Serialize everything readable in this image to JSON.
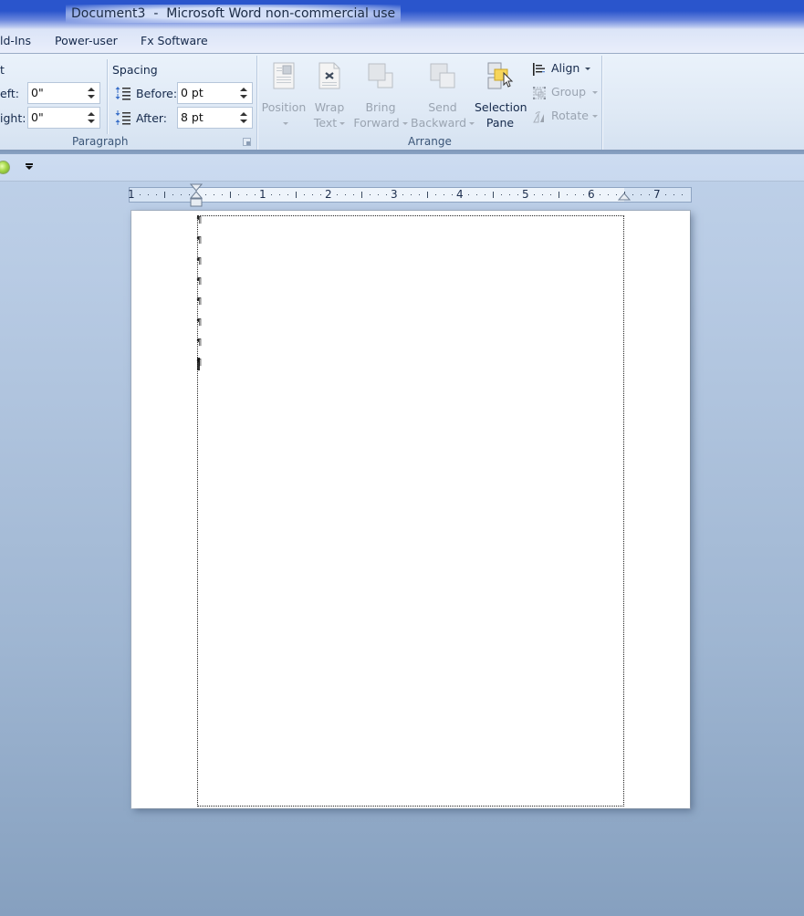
{
  "window": {
    "title": "Document3  -  Microsoft Word non-commercial use"
  },
  "tabs": [
    {
      "label": "ld-Ins"
    },
    {
      "label": "Power-user"
    },
    {
      "label": "Fx Software"
    }
  ],
  "ribbon": {
    "paragraph_group": {
      "label": "Paragraph",
      "indent": {
        "header_partial": "t",
        "left_label": "eft:",
        "left_value": "0\"",
        "right_label": "ight:",
        "right_value": "0\""
      },
      "spacing": {
        "header": "Spacing",
        "before_label": "Before:",
        "before_value": "0 pt",
        "after_label": "After:",
        "after_value": "8 pt"
      }
    },
    "arrange_group": {
      "label": "Arrange",
      "buttons": [
        {
          "line1": "Position",
          "line2": "",
          "enabled": false,
          "dropdown": true
        },
        {
          "line1": "Wrap",
          "line2": "Text",
          "enabled": false,
          "dropdown": true
        },
        {
          "line1": "Bring",
          "line2": "Forward",
          "enabled": false,
          "dropdown": true
        },
        {
          "line1": "Send",
          "line2": "Backward",
          "enabled": false,
          "dropdown": true
        },
        {
          "line1": "Selection",
          "line2": "Pane",
          "enabled": true,
          "dropdown": false
        }
      ],
      "small_buttons": [
        {
          "label": "Align",
          "enabled": true
        },
        {
          "label": "Group",
          "enabled": false
        },
        {
          "label": "Rotate",
          "enabled": false
        }
      ]
    }
  },
  "ruler": {
    "labels": [
      "1",
      "1",
      "2",
      "3",
      "4",
      "5",
      "6",
      "7"
    ]
  },
  "document": {
    "paragraph_mark": "¶",
    "empty_paragraph_count": 8
  },
  "colors": {
    "title_bar": "#2a55cc",
    "ribbon_bg": "#dfe9f5",
    "workspace_bg": "#9fb6d2",
    "page_bg": "#ffffff"
  }
}
